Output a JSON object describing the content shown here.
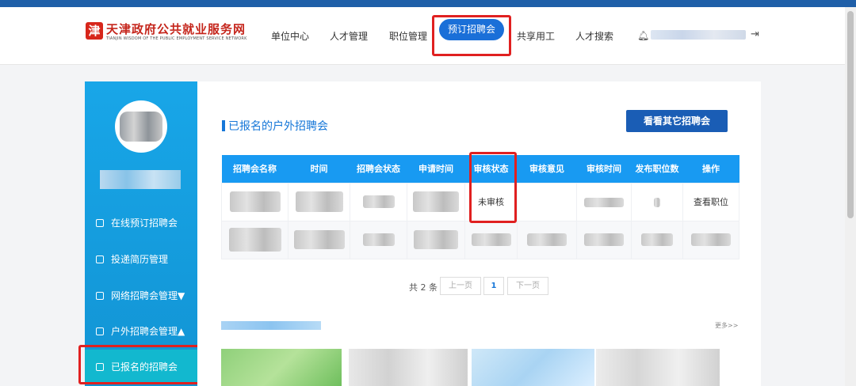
{
  "header": {
    "logo_badge": "津",
    "logo_cn": "天津政府公共就业服务网",
    "logo_en": "TIANJIN WISDOM OF THE PUBLIC EMPLOYMENT SERVICE NETWORK",
    "nav": [
      "单位中心",
      "人才管理",
      "职位管理",
      "预订招聘会",
      "共享用工",
      "人才搜索"
    ],
    "active_nav": "预订招聘会"
  },
  "sidebar": {
    "items": [
      {
        "label": "在线预订招聘会",
        "icon": "calendar-icon"
      },
      {
        "label": "投递简历管理",
        "icon": "briefcase-icon"
      },
      {
        "label": "网络招聘会管理▼",
        "icon": "briefcase-icon"
      },
      {
        "label": "户外招聘会管理▲",
        "icon": "briefcase-icon"
      },
      {
        "label": "已报名的招聘会",
        "icon": "calendar-icon"
      }
    ],
    "active": "已报名的招聘会"
  },
  "main": {
    "title": "已报名的户外招聘会",
    "other_button": "看看其它招聘会",
    "table": {
      "columns": [
        "招聘会名称",
        "时间",
        "招聘会状态",
        "申请时间",
        "审核状态",
        "审核意见",
        "审核时间",
        "发布职位数",
        "操作"
      ],
      "rows": [
        {
          "review_status": "未审核",
          "action": "查看职位"
        },
        {
          "review_status": "",
          "action": ""
        }
      ]
    },
    "pager": {
      "total": "共 2 条",
      "prev": "上一页",
      "current": "1",
      "next": "下一页"
    },
    "more": "更多>>"
  },
  "colors": {
    "primary": "#1a6fd8",
    "sidebar": "#18a6e8",
    "sidebar_active": "#12b8cf",
    "table_header": "#189af2",
    "highlight": "#e02020"
  }
}
